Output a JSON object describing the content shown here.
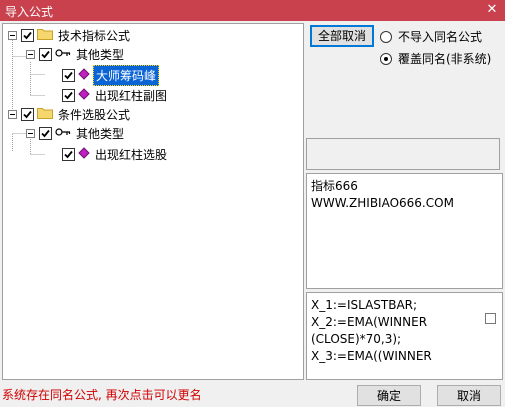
{
  "window": {
    "title": "导入公式",
    "close_glyph": "✕"
  },
  "tree": {
    "nodes": [
      {
        "label": "技术指标公式",
        "level": 0
      },
      {
        "label": "其他类型",
        "level": 1
      },
      {
        "label": "大师筹码峰",
        "level": 2,
        "selected": true
      },
      {
        "label": "出现红柱副图",
        "level": 2
      },
      {
        "label": "条件选股公式",
        "level": 0
      },
      {
        "label": "其他类型",
        "level": 1
      },
      {
        "label": "出现红柱选股",
        "level": 2
      }
    ]
  },
  "buttons": {
    "select_all": "全部取消",
    "ok": "确定",
    "cancel": "取消"
  },
  "options": {
    "no_import": "不导入同名公式",
    "overwrite": "覆盖同名(非系统)",
    "selected": "overwrite"
  },
  "description": {
    "line1": "指标666",
    "line2": "WWW.ZHIBIAO666.COM"
  },
  "code": {
    "line1": "X_1:=ISLASTBAR;",
    "line2": "X_2:=EMA(WINNER",
    "line3": "(CLOSE)*70,3);",
    "line4": "X_3:=EMA((WINNER"
  },
  "status": "系统存在同名公式, 再次点击可以更名",
  "icons": {
    "folder": "folder-icon",
    "key": "key-icon",
    "formula": "diamond-formula-icon"
  },
  "colors": {
    "titlebar": "#c8414d",
    "selection": "#0a64d6",
    "status_text": "#d00000"
  }
}
